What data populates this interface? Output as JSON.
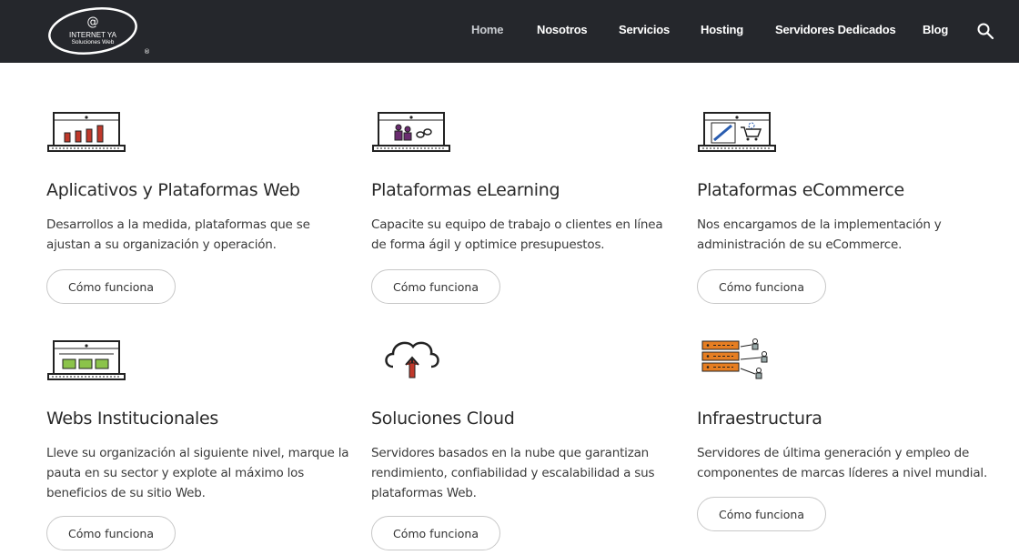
{
  "header": {
    "logo": {
      "line1": "INTERNET YA",
      "line2": "Soluciones Web",
      "mark": "@",
      "reg": "®"
    },
    "nav": [
      {
        "label": "Home",
        "active": true
      },
      {
        "label": "Nosotros"
      },
      {
        "label": "Servicios"
      },
      {
        "label": "Hosting"
      },
      {
        "label": "Servidores Dedicados"
      },
      {
        "label": "Blog"
      }
    ],
    "search_icon": "search-icon"
  },
  "services": [
    {
      "icon": "laptop-bar-chart-icon",
      "title": "Aplicativos y Plataformas Web",
      "description": "Desarrollos a la medida, plataformas que se ajustan a su organización y operación.",
      "button": "Cómo funciona"
    },
    {
      "icon": "laptop-people-icon",
      "title": "Plataformas eLearning",
      "description": "Capacite su equipo de trabajo o clientes en línea de forma ágil y optimice presupuestos.",
      "button": "Cómo funciona"
    },
    {
      "icon": "laptop-cart-icon",
      "title": "Plataformas eCommerce",
      "description": "Nos encargamos de la implementación y administración de su eCommerce.",
      "button": "Cómo funciona"
    },
    {
      "icon": "laptop-layout-icon",
      "title": "Webs Institucionales",
      "description": "Lleve su organización al siguiente nivel, marque la pauta en su sector y explote al máximo los beneficios de su sitio Web.",
      "button": "Cómo funciona"
    },
    {
      "icon": "cloud-upload-icon",
      "title": "Soluciones Cloud",
      "description": "Servidores basados en la nube que garantizan rendimiento, confiabilidad y escalabilidad a sus plataformas Web.",
      "button": "Cómo funciona"
    },
    {
      "icon": "server-rack-icon",
      "title": "Infraestructura",
      "description": "Servidores de última generación y empleo de componentes de marcas líderes a nivel mundial.",
      "button": "Cómo funciona"
    }
  ],
  "colors": {
    "header_bg": "#25272c",
    "accent_red": "#c0392b",
    "accent_green": "#8bc34a",
    "accent_orange": "#e67e22"
  }
}
